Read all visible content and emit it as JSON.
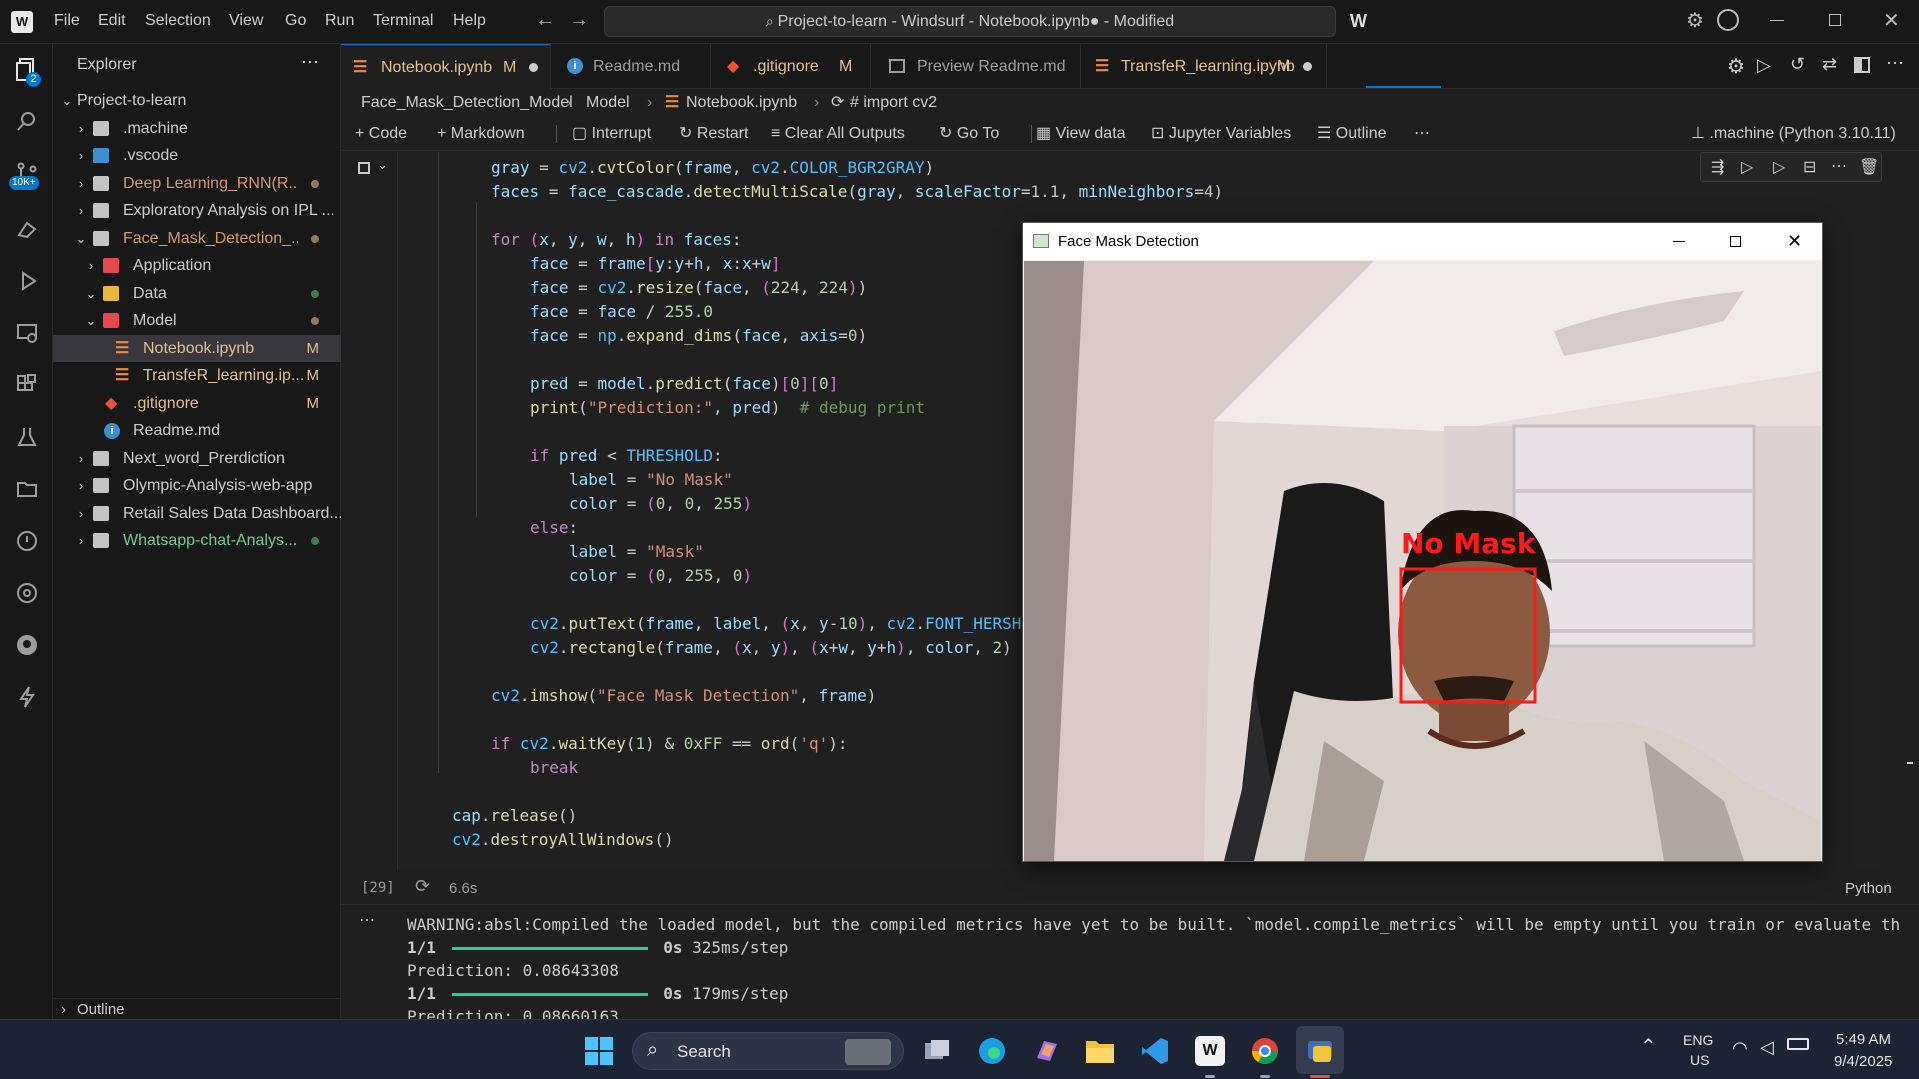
{
  "titlebar": {
    "menu": [
      "File",
      "Edit",
      "Selection",
      "View",
      "Go",
      "Run",
      "Terminal",
      "Help"
    ],
    "command_center": "Project-to-learn - Windsurf - Notebook.ipynb● - Modified"
  },
  "activity": {
    "explorer_badge": "2",
    "source_control_badge": "10K+"
  },
  "sidebar": {
    "title": "Explorer",
    "root": "Project-to-learn",
    "items": [
      {
        "label": ".machine"
      },
      {
        "label": ".vscode"
      },
      {
        "label": "Deep Learning_RNN(R..."
      },
      {
        "label": "Exploratory Analysis on IPL ..."
      },
      {
        "label": "Face_Mask_Detection_..."
      },
      {
        "label": "Application"
      },
      {
        "label": "Data"
      },
      {
        "label": "Model"
      },
      {
        "label": "Notebook.ipynb",
        "status": "M"
      },
      {
        "label": "TransfeR_learning.ip...",
        "status": "M"
      },
      {
        "label": ".gitignore",
        "status": "M"
      },
      {
        "label": "Readme.md"
      },
      {
        "label": "Next_word_Prerdiction"
      },
      {
        "label": "Olympic-Analysis-web-app"
      },
      {
        "label": "Retail Sales Data Dashboard..."
      },
      {
        "label": "Whatsapp-chat-Analys..."
      }
    ],
    "outline": "Outline"
  },
  "tabs": [
    {
      "label": "Notebook.ipynb",
      "status": "M"
    },
    {
      "label": "Readme.md"
    },
    {
      "label": ".gitignore",
      "status": "M"
    },
    {
      "label": "Preview Readme.md"
    },
    {
      "label": "TransfeR_learning.ipynb",
      "status": "M"
    }
  ],
  "breadcrumb": [
    "Face_Mask_Detection_Model",
    "Model",
    "Notebook.ipynb",
    "# import cv2"
  ],
  "toolbar": {
    "code": "Code",
    "markdown": "Markdown",
    "interrupt": "Interrupt",
    "restart": "Restart",
    "clear": "Clear All Outputs",
    "goto": "Go To",
    "viewdata": "View data",
    "jupyter_vars": "Jupyter Variables",
    "outline": "Outline",
    "kernel": ".machine (Python 3.10.11)"
  },
  "cell": {
    "exec_count": "[29]",
    "duration": "6.6s",
    "language": "Python"
  },
  "outputs": {
    "warning": "WARNING:absl:Compiled the loaded model, but the compiled metrics have yet to be built. `model.compile_metrics` will be empty until you train or evaluate th",
    "step1_count": "1/1",
    "step1_time": "0s",
    "step1_rate": "325ms/step",
    "pred1": "Prediction: 0.08643308",
    "step2_count": "1/1",
    "step2_time": "0s",
    "step2_rate": "179ms/step",
    "pred2": "Prediction: 0.08660163"
  },
  "face_window": {
    "title": "Face Mask Detection",
    "detection_label": "No Mask"
  },
  "taskbar": {
    "search": "Search",
    "lang_top": "ENG",
    "lang_bottom": "US",
    "time": "5:49 AM",
    "date": "9/4/2025"
  }
}
